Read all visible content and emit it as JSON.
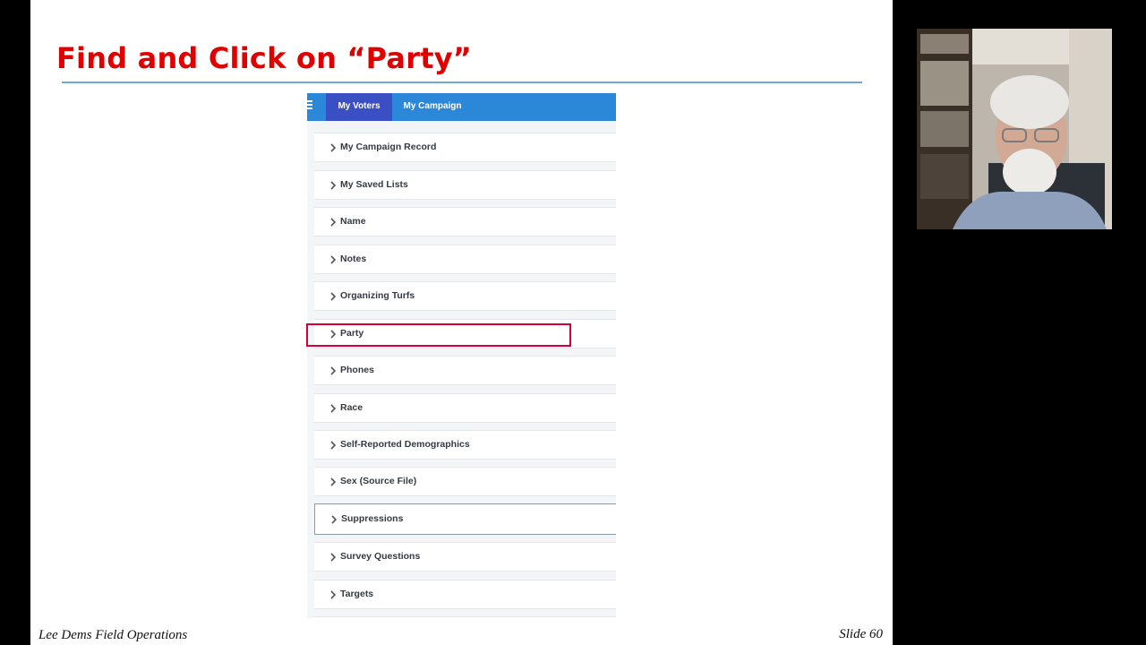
{
  "slide": {
    "title": "Find and Click on “Party”",
    "footer_left": "Lee Dems Field Operations",
    "footer_right": "Slide 60"
  },
  "app": {
    "tabs": [
      {
        "label": "My Voters",
        "active": true
      },
      {
        "label": "My Campaign",
        "active": false
      }
    ],
    "accordion_items": [
      {
        "label": "My Campaign Record"
      },
      {
        "label": "My Saved Lists"
      },
      {
        "label": "Name"
      },
      {
        "label": "Notes"
      },
      {
        "label": "Organizing Turfs"
      },
      {
        "label": "Party",
        "highlighted": true
      },
      {
        "label": "Phones"
      },
      {
        "label": "Race"
      },
      {
        "label": "Self-Reported Demographics"
      },
      {
        "label": "Sex (Source File)"
      },
      {
        "label": "Suppressions"
      },
      {
        "label": "Survey Questions"
      },
      {
        "label": "Targets"
      }
    ]
  },
  "colors": {
    "title": "#e00000",
    "topbar": "#2b87d8",
    "active_tab": "#3b4fc5",
    "highlight": "#d4003a",
    "title_rule": "#6fa8d8"
  },
  "icons": [
    "hamburger-icon",
    "chevron-right-icon"
  ]
}
